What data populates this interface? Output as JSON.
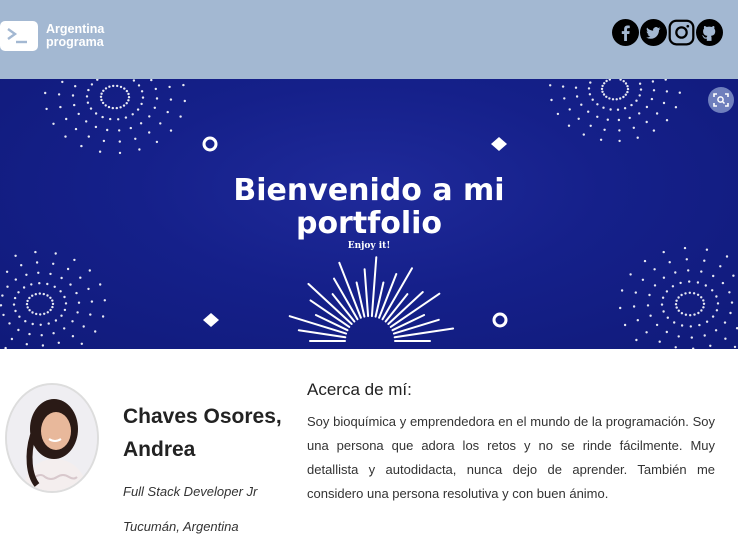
{
  "header": {
    "logo_line1": "Argentina",
    "logo_line2": "programa",
    "socials": [
      "facebook-icon",
      "twitter-icon",
      "instagram-icon",
      "github-icon"
    ]
  },
  "banner": {
    "title_line1": "Bienvenido a mi",
    "title_line2": "portfolio",
    "subtitle": "Enjoy it!"
  },
  "profile": {
    "name_line1": "Chaves Osores,",
    "name_line2": "Andrea",
    "role": "Full Stack Developer Jr",
    "location": "Tucumán, Argentina"
  },
  "about": {
    "title": "Acerca de mí:",
    "text": "Soy bioquímica y emprendedora en el mundo de la programación. Soy una persona que adora los retos y no se rinde fácilmente. Muy detallista y autodidacta, nunca dejo de aprender. También me considero una persona resolutiva y con buen ánimo."
  },
  "colors": {
    "header_bg": "#a3b8d2",
    "banner_bg": "#15208a"
  }
}
